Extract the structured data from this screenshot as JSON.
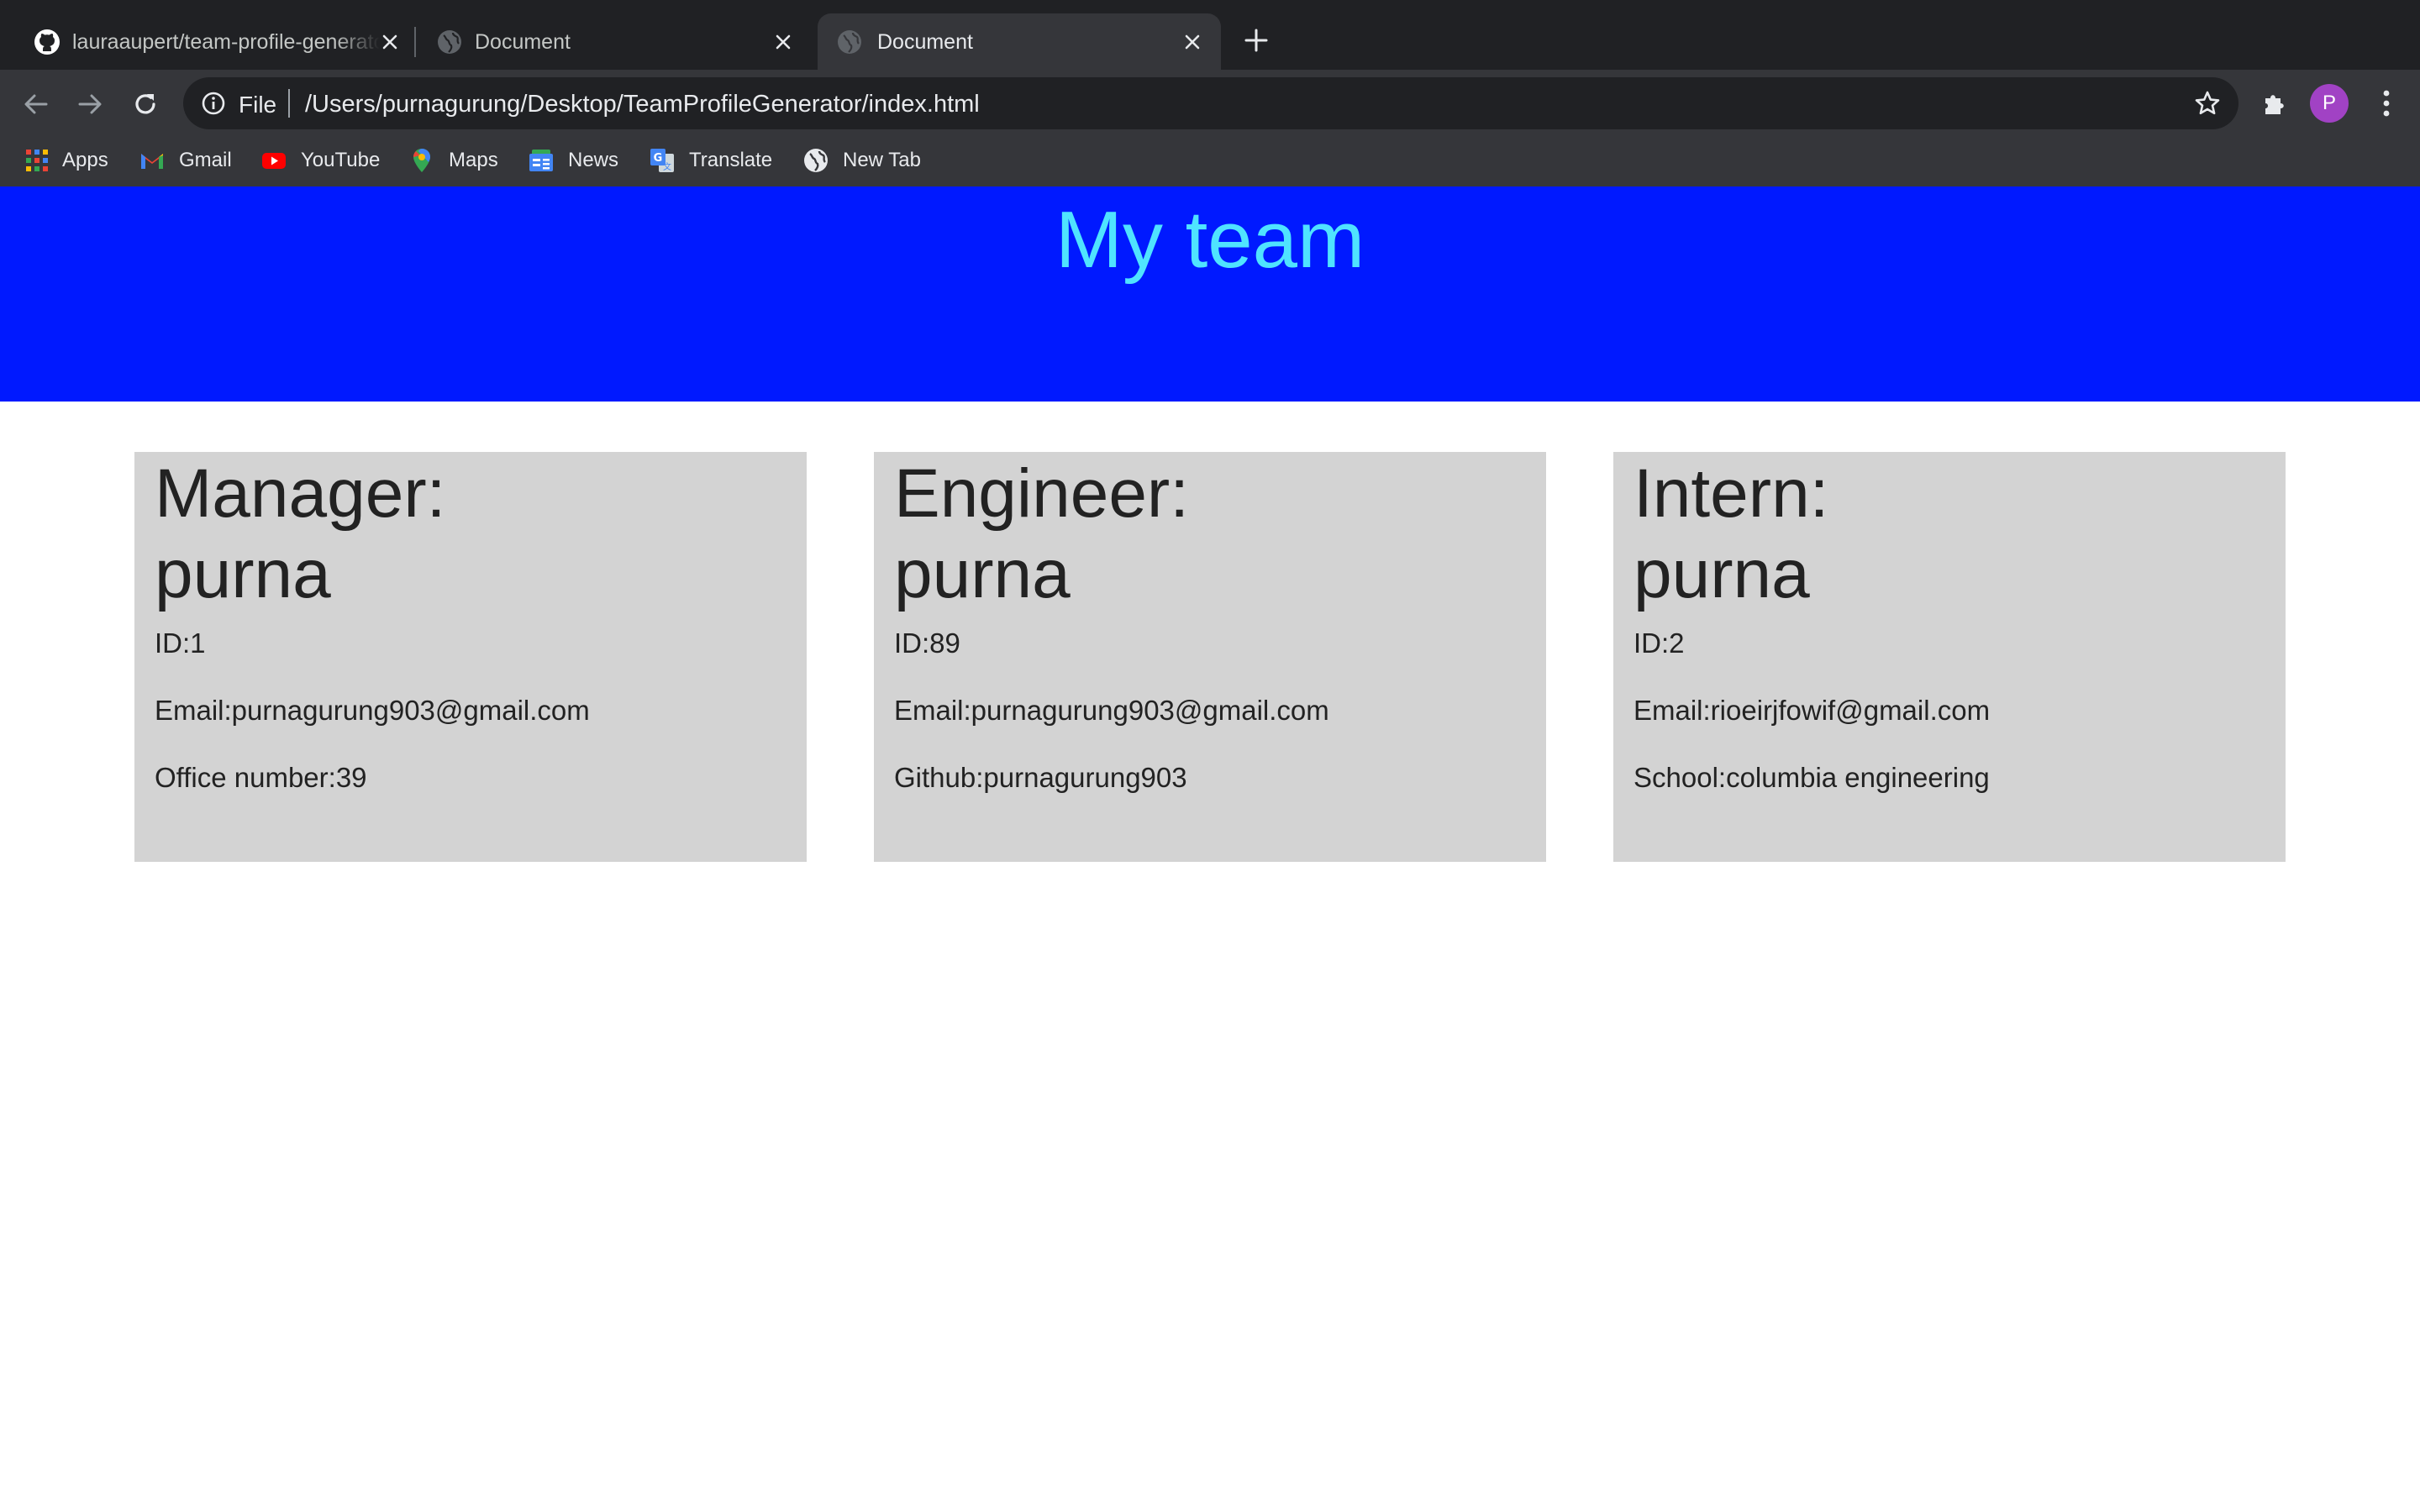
{
  "browser": {
    "tabs": [
      {
        "title": "lauraaupert/team-profile-generator",
        "icon": "github-icon",
        "active": false
      },
      {
        "title": "Document",
        "icon": "globe-icon",
        "active": false
      },
      {
        "title": "Document",
        "icon": "globe-icon",
        "active": true
      }
    ],
    "omnibox": {
      "scheme_label": "File",
      "url": "/Users/purnagurung/Desktop/TeamProfileGenerator/index.html"
    },
    "profile_initial": "P",
    "bookmarks": [
      {
        "label": "Apps",
        "icon": "apps-grid-icon"
      },
      {
        "label": "Gmail",
        "icon": "gmail-icon"
      },
      {
        "label": "YouTube",
        "icon": "youtube-icon"
      },
      {
        "label": "Maps",
        "icon": "maps-pin-icon"
      },
      {
        "label": "News",
        "icon": "news-icon"
      },
      {
        "label": "Translate",
        "icon": "translate-icon"
      },
      {
        "label": "New Tab",
        "icon": "globe-icon"
      }
    ]
  },
  "page": {
    "title": "My team",
    "cards": [
      {
        "role": "Manager:",
        "name": "purna",
        "id": "ID:1",
        "email": "Email:purnagurung903@gmail.com",
        "extra": "Office number:39"
      },
      {
        "role": "Engineer:",
        "name": "purna",
        "id": "ID:89",
        "email": "Email:purnagurung903@gmail.com",
        "extra": "Github:purnagurung903"
      },
      {
        "role": "Intern:",
        "name": "purna",
        "id": "ID:2",
        "email": "Email:rioeirjfowif@gmail.com",
        "extra": "School:columbia engineering"
      }
    ]
  },
  "colors": {
    "hero_background": "#0019ff",
    "hero_title": "#4fe3ff",
    "card_background": "#d3d3d3",
    "profile_avatar": "#a142c4"
  }
}
